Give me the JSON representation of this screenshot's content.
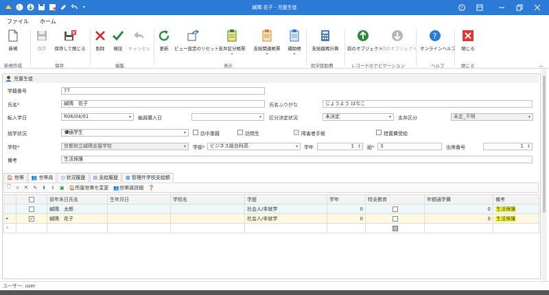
{
  "window": {
    "title": "緘隅 花子 - 児童生徒"
  },
  "menu": {
    "file": "ファイル",
    "home": "ホーム"
  },
  "ribbon": {
    "new": "新規",
    "save": "保存",
    "save_close": "保存して閉じる",
    "delete": "削除",
    "verify": "検証",
    "cancel": "キャンセル",
    "refresh": "更新",
    "view_reset": "ビュー設定のリセット",
    "support_form": "支弁区分帳票",
    "support_related": "支給関連帳票",
    "aux_form": "補助帳",
    "calc": "支給額再計算",
    "prev": "前のオブジェクト",
    "next": "次のオブジェクト",
    "help": "オンラインヘルプ",
    "close": "閉じる",
    "groups": {
      "new": "新規作成",
      "save": "保存",
      "edit": "編集",
      "display": "表示",
      "study": "就学奨励費",
      "record_nav": "レコードのナビゲーション",
      "help": "ヘルプ",
      "close": "閉じる"
    }
  },
  "panel": {
    "title": "児童生徒"
  },
  "form": {
    "student_no_label": "学籍番号",
    "student_no": "77",
    "name_label": "氏名",
    "name": "緘隅　花子",
    "kana_label": "氏名ふりがな",
    "kana": "じょうよう はなこ",
    "transfer_label": "転入学日",
    "transfer": "R06/04/01",
    "staff_label": "編員購入日",
    "staff": "",
    "decision_label": "区分決定状況",
    "decision": "未決定",
    "support_label": "支弁区分",
    "support": "未定_不明",
    "status_label": "就学状況",
    "status": "通学生",
    "chk1": "訪中重籍",
    "chk2": "訪問生",
    "chk3": "障害者手帳",
    "chk4": "措置費受給",
    "school_label": "学校",
    "school": "京都府立緘隅支援学校",
    "dept_label": "学部",
    "dept": "ビジネス総合科高",
    "grade_label": "学年",
    "grade": "1",
    "class_label": "組",
    "class": "3",
    "att_label": "出席番号",
    "att": "1",
    "remarks_label": "備考",
    "remarks": "生活保護"
  },
  "tabs": [
    "世帯",
    "世帯員",
    "状況履歴",
    "支給履歴",
    "管理外学校支給額"
  ],
  "gridtool": {
    "change_household": "所属世帯を変更",
    "member_detail": "世帯員詳細"
  },
  "grid": {
    "headers": [
      "前年末日氏名",
      "生年月日",
      "学校名",
      "学歴",
      "学年",
      "特支教育",
      "年額通学費",
      "備考"
    ],
    "rows": [
      {
        "name": "緘隅　太郎",
        "birth": "",
        "school": "",
        "career": "社会人/非就学",
        "grade": "0",
        "fee": "0",
        "remark": "生活保護",
        "checked": false
      },
      {
        "name": "緘隅　花子",
        "birth": "",
        "school": "",
        "career": "社会人/非就学",
        "grade": "0",
        "fee": "0",
        "remark": "生活保護",
        "checked": true
      }
    ]
  },
  "status": {
    "user": "ユーザー: user"
  }
}
